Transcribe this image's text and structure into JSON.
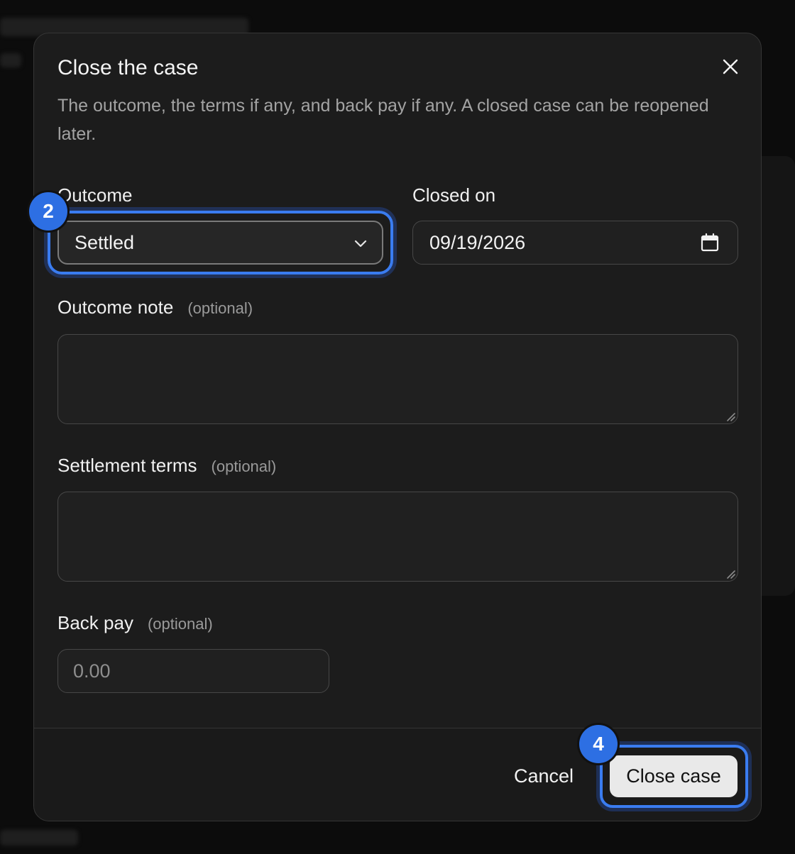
{
  "dialog": {
    "title": "Close the case",
    "description": "The outcome, the terms if any, and back pay if any. A closed case can be reopened later.",
    "close_icon": "close-icon"
  },
  "form": {
    "outcome": {
      "label": "Outcome",
      "value": "Settled",
      "icon": "chevron-down-icon"
    },
    "closed_on": {
      "label": "Closed on",
      "value": "09/19/2026",
      "icon": "calendar-icon"
    },
    "outcome_note": {
      "label": "Outcome note",
      "optional": "(optional)",
      "value": ""
    },
    "settlement_terms": {
      "label": "Settlement terms",
      "optional": "(optional)",
      "value": ""
    },
    "back_pay": {
      "label": "Back pay",
      "optional": "(optional)",
      "placeholder": "0.00"
    }
  },
  "footer": {
    "cancel_label": "Cancel",
    "submit_label": "Close case"
  },
  "annotations": {
    "badge_outcome": "2",
    "badge_submit": "4"
  },
  "colors": {
    "accent": "#2d6fe3",
    "dialog_bg": "#1c1c1c",
    "primary_button": "#e9e9e9"
  }
}
